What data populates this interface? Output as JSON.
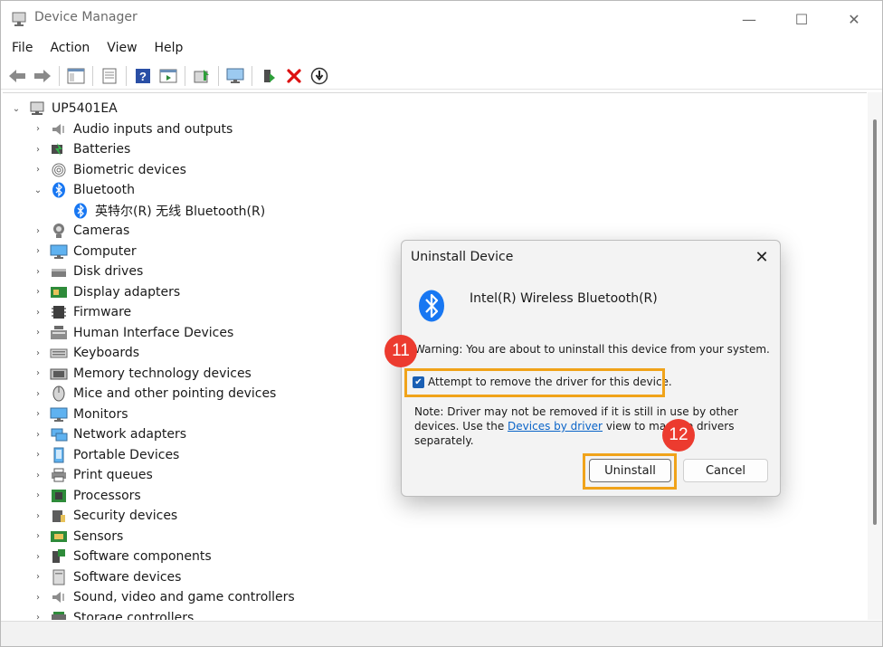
{
  "window": {
    "title": "Device Manager",
    "controls": {
      "minimize": "—",
      "maximize": "☐",
      "close": "✕"
    }
  },
  "menu": [
    "File",
    "Action",
    "View",
    "Help"
  ],
  "toolbar_icons": [
    "back-icon",
    "forward-icon",
    "show-hide-tree-icon",
    "properties-icon",
    "help-icon",
    "view-icon",
    "update-driver-icon",
    "scan-hardware-icon",
    "enable-device-icon",
    "uninstall-icon",
    "disable-icon"
  ],
  "tree": {
    "root": "UP5401EA",
    "categories": [
      {
        "label": "Audio inputs and outputs",
        "icon": "speaker-icon",
        "expanded": false
      },
      {
        "label": "Batteries",
        "icon": "battery-icon",
        "expanded": false
      },
      {
        "label": "Biometric devices",
        "icon": "fingerprint-icon",
        "expanded": false
      },
      {
        "label": "Bluetooth",
        "icon": "bluetooth-icon",
        "expanded": true
      },
      {
        "label": "英特尔(R) 无线 Bluetooth(R)",
        "icon": "bluetooth-icon",
        "child": true
      },
      {
        "label": "Cameras",
        "icon": "camera-icon",
        "expanded": false
      },
      {
        "label": "Computer",
        "icon": "monitor-icon",
        "expanded": false
      },
      {
        "label": "Disk drives",
        "icon": "disk-icon",
        "expanded": false
      },
      {
        "label": "Display adapters",
        "icon": "display-adapter-icon",
        "expanded": false
      },
      {
        "label": "Firmware",
        "icon": "chip-icon",
        "expanded": false
      },
      {
        "label": "Human Interface Devices",
        "icon": "hid-icon",
        "expanded": false
      },
      {
        "label": "Keyboards",
        "icon": "keyboard-icon",
        "expanded": false
      },
      {
        "label": "Memory technology devices",
        "icon": "memory-icon",
        "expanded": false
      },
      {
        "label": "Mice and other pointing devices",
        "icon": "mouse-icon",
        "expanded": false
      },
      {
        "label": "Monitors",
        "icon": "monitor-icon",
        "expanded": false
      },
      {
        "label": "Network adapters",
        "icon": "network-icon",
        "expanded": false
      },
      {
        "label": "Portable Devices",
        "icon": "portable-device-icon",
        "expanded": false
      },
      {
        "label": "Print queues",
        "icon": "printer-icon",
        "expanded": false
      },
      {
        "label": "Processors",
        "icon": "processor-icon",
        "expanded": false
      },
      {
        "label": "Security devices",
        "icon": "security-icon",
        "expanded": false
      },
      {
        "label": "Sensors",
        "icon": "sensor-icon",
        "expanded": false
      },
      {
        "label": "Software components",
        "icon": "software-component-icon",
        "expanded": false
      },
      {
        "label": "Software devices",
        "icon": "software-device-icon",
        "expanded": false
      },
      {
        "label": "Sound, video and game controllers",
        "icon": "speaker-icon",
        "expanded": false
      },
      {
        "label": "Storage controllers",
        "icon": "storage-icon",
        "expanded": false
      }
    ]
  },
  "dialog": {
    "title": "Uninstall Device",
    "device_name": "Intel(R) Wireless Bluetooth(R)",
    "warning": "Warning: You are about to uninstall this device from your system.",
    "checkbox_label": "Attempt to remove the driver for this device.",
    "checkbox_checked": true,
    "note_before_link": "Note: Driver may not be removed if it is still in use by other devices. Use the ",
    "note_link": "Devices by driver",
    "note_after_link": " view to manage drivers separately.",
    "uninstall_label": "Uninstall",
    "cancel_label": "Cancel"
  },
  "annotations": {
    "step_checkbox": "11",
    "step_uninstall": "12"
  },
  "colors": {
    "highlight": "#f0a31a",
    "badge": "#ec3b2f",
    "bluetooth": "#1877f2",
    "link": "#0a64c8"
  }
}
